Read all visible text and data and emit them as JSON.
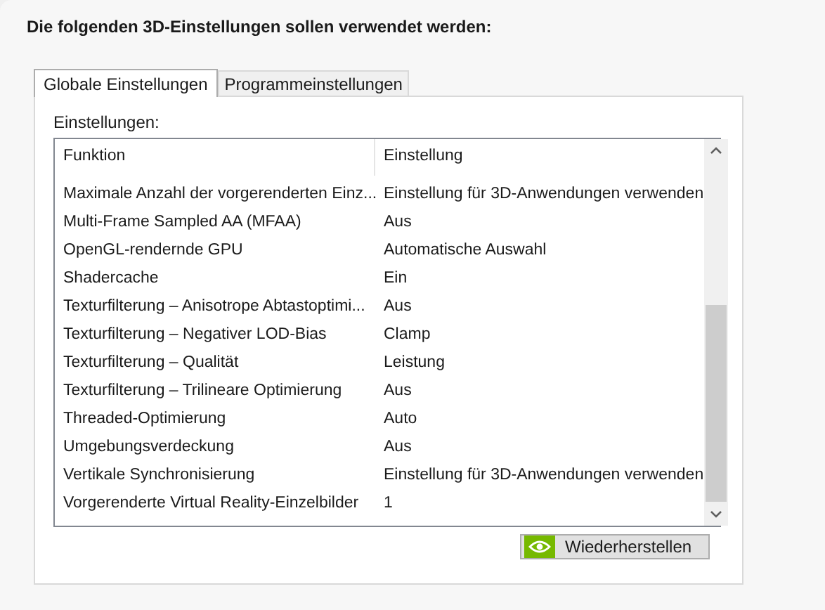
{
  "heading": "Die folgenden 3D-Einstellungen sollen verwendet werden:",
  "tabs": [
    {
      "label": "Globale Einstellungen",
      "selected": true
    },
    {
      "label": "Programmeinstellungen",
      "selected": false
    }
  ],
  "settings_label": "Einstellungen:",
  "table": {
    "columns": [
      "Funktion",
      "Einstellung"
    ],
    "rows": [
      [
        "Maximale Anzahl der vorgerenderten Einz...",
        "Einstellung für 3D-Anwendungen verwenden"
      ],
      [
        "Multi-Frame Sampled AA (MFAA)",
        "Aus"
      ],
      [
        "OpenGL-rendernde GPU",
        "Automatische Auswahl"
      ],
      [
        "Shadercache",
        "Ein"
      ],
      [
        "Texturfilterung – Anisotrope Abtastoptimi...",
        "Aus"
      ],
      [
        "Texturfilterung – Negativer LOD-Bias",
        "Clamp"
      ],
      [
        "Texturfilterung – Qualität",
        "Leistung"
      ],
      [
        "Texturfilterung – Trilineare Optimierung",
        "Aus"
      ],
      [
        "Threaded-Optimierung",
        "Auto"
      ],
      [
        "Umgebungsverdeckung",
        "Aus"
      ],
      [
        "Vertikale Synchronisierung",
        "Einstellung für 3D-Anwendungen verwenden"
      ],
      [
        "Vorgerenderte Virtual Reality-Einzelbilder",
        "1"
      ]
    ]
  },
  "restore_button": "Wiederherstellen"
}
